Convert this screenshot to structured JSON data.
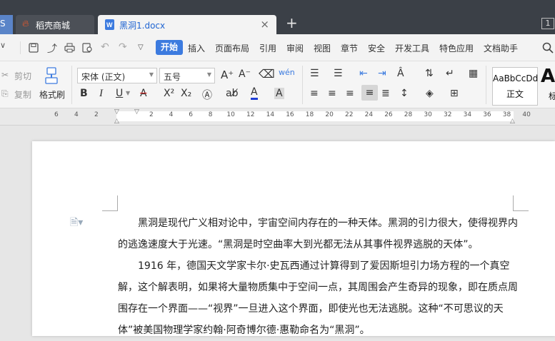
{
  "tabs": {
    "stub_label": "S",
    "store_label": "稻壳商城",
    "doc_label": "黑洞1.docx",
    "close_glyph": "×",
    "add_glyph": "+",
    "window_count": "1"
  },
  "menu": {
    "start": "开始",
    "items": [
      "插入",
      "页面布局",
      "引用",
      "审阅",
      "视图",
      "章节",
      "安全",
      "开发工具",
      "特色应用",
      "文档助手"
    ]
  },
  "ribbon": {
    "cut": "剪切",
    "copy": "复制",
    "format_painter": "格式刷",
    "font_name": "宋体 (正文)",
    "font_size": "五号",
    "style_preview": "AaBbCcDd",
    "style_name": "正文",
    "style_big": "Aa",
    "style_big_label": "标"
  },
  "ruler": {
    "left_numbers": [
      "6",
      "4",
      "2"
    ],
    "right_numbers": [
      "2",
      "4",
      "6",
      "8",
      "10",
      "12",
      "14",
      "16",
      "18",
      "20",
      "22",
      "24",
      "26",
      "28",
      "30",
      "32",
      "34",
      "36",
      "38",
      "40"
    ]
  },
  "document": {
    "lines": [
      "　　黑洞是现代广义相对论中，宇宙空间内存在的一种天体。黑洞的引力很大，使得视界内",
      "的逃逸速度大于光速。“黑洞是时空曲率大到光都无法从其事件视界逃脱的天体”。",
      "　　1916 年，德国天文学家卡尔·史瓦西通过计算得到了爱因斯坦引力场方程的一个真空",
      "解，这个解表明，如果将大量物质集中于空间一点，其周围会产生奇异的现象，即在质点周",
      "围存在一个界面——“视界”一旦进入这个界面，即使光也无法逃脱。这种“不可思议的天",
      "体”被美国物理学家约翰·阿奇博尔德·惠勒命名为“黑洞”。"
    ]
  },
  "colors": {
    "accent": "#3c7bdf",
    "titlebar": "#3b4047",
    "font_color_bar": "#1f3fd6",
    "highlight_red": "#e02020"
  },
  "icons": [
    "menu-arrow-icon",
    "save-icon",
    "export-icon",
    "print-icon",
    "print-preview-icon",
    "undo-icon",
    "redo-icon",
    "search-icon"
  ]
}
